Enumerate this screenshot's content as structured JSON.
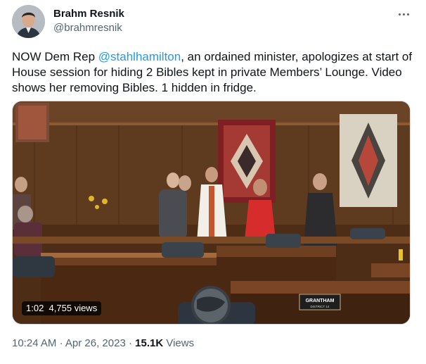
{
  "author": {
    "name": "Brahm Resnik",
    "handle": "@brahmresnik"
  },
  "tweet": {
    "text_before": "NOW Dem Rep ",
    "mention": "@stahlhamilton",
    "text_after": ", an ordained minister, apologizes at start of House session for hiding 2 Bibles kept in private Members’ Lounge. Video shows her removing Bibles. 1 hidden in fridge."
  },
  "video": {
    "duration": "1:02",
    "views": "4,755 views",
    "desk_sign": {
      "name": "GRANTHAM",
      "district": "DISTRICT 14"
    }
  },
  "meta": {
    "time": "10:24 AM",
    "separator": "·",
    "date": "Apr 26, 2023",
    "view_count": "15.1K",
    "views_label": "Views"
  },
  "icons": {
    "more": "more-horizontal-icon",
    "avatar": "avatar"
  },
  "colors": {
    "accent": "#1d9bf0",
    "text": "#0f1419",
    "secondary": "#536471"
  }
}
